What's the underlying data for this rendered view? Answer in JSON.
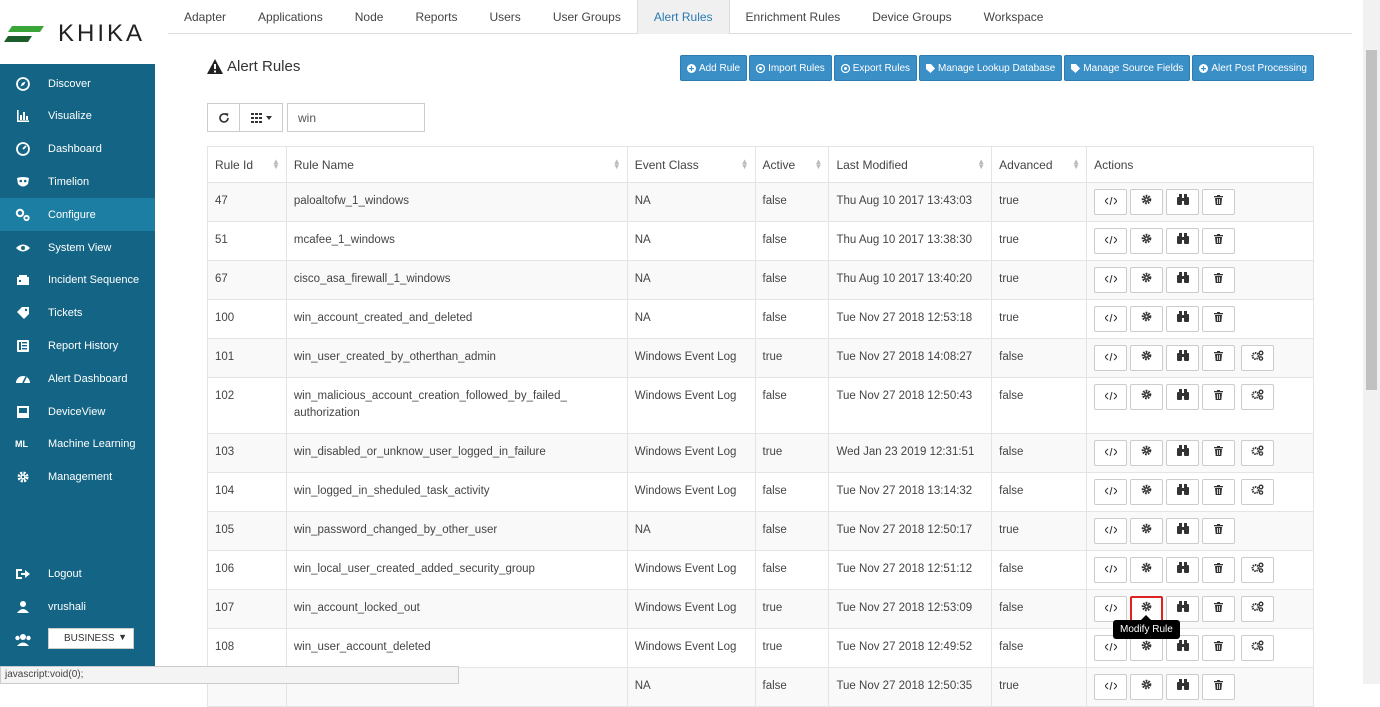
{
  "brand": {
    "name": "KHIKA"
  },
  "sidebar": {
    "items": [
      {
        "label": "Discover",
        "icon": "compass-icon"
      },
      {
        "label": "Visualize",
        "icon": "bar-chart-icon"
      },
      {
        "label": "Dashboard",
        "icon": "dashboard-icon"
      },
      {
        "label": "Timelion",
        "icon": "mask-icon"
      },
      {
        "label": "Configure",
        "icon": "cogs-icon",
        "active": true
      },
      {
        "label": "System View",
        "icon": "eye-icon"
      },
      {
        "label": "Incident Sequence",
        "icon": "incident-icon"
      },
      {
        "label": "Tickets",
        "icon": "tag-icon"
      },
      {
        "label": "Report History",
        "icon": "list-icon"
      },
      {
        "label": "Alert Dashboard",
        "icon": "gauge-icon"
      },
      {
        "label": "DeviceView",
        "icon": "device-icon"
      },
      {
        "label": "Machine Learning",
        "icon": "ml-icon"
      },
      {
        "label": "Management",
        "icon": "gear-icon"
      }
    ],
    "bottom": [
      {
        "label": "Logout",
        "icon": "logout-icon"
      },
      {
        "label": "vrushali",
        "icon": "user-icon"
      }
    ],
    "business_select": "BUSINESS"
  },
  "tabs": [
    "Adapter",
    "Applications",
    "Node",
    "Reports",
    "Users",
    "User Groups",
    "Alert Rules",
    "Enrichment Rules",
    "Device Groups",
    "Workspace"
  ],
  "active_tab": "Alert Rules",
  "page_title": "Alert Rules",
  "toolbar": {
    "add_rule": "Add Rule",
    "import_rules": "Import Rules",
    "export_rules": "Export Rules",
    "manage_lookup": "Manage Lookup Database",
    "manage_source": "Manage Source Fields",
    "alert_post": "Alert Post Processing"
  },
  "search": {
    "value": "win"
  },
  "table": {
    "columns": [
      "Rule Id",
      "Rule Name",
      "Event Class",
      "Active",
      "Last Modified",
      "Advanced",
      "Actions"
    ],
    "rows": [
      {
        "id": "47",
        "name": "paloaltofw_1_windows",
        "event_class": "NA",
        "active": "false",
        "modified": "Thu Aug 10 2017 13:43:03",
        "advanced": "true",
        "extra": false
      },
      {
        "id": "51",
        "name": "mcafee_1_windows",
        "event_class": "NA",
        "active": "false",
        "modified": "Thu Aug 10 2017 13:38:30",
        "advanced": "true",
        "extra": false
      },
      {
        "id": "67",
        "name": "cisco_asa_firewall_1_windows",
        "event_class": "NA",
        "active": "false",
        "modified": "Thu Aug 10 2017 13:40:20",
        "advanced": "true",
        "extra": false
      },
      {
        "id": "100",
        "name": "win_account_created_and_deleted",
        "event_class": "NA",
        "active": "false",
        "modified": "Tue Nov 27 2018 12:53:18",
        "advanced": "true",
        "extra": false
      },
      {
        "id": "101",
        "name": "win_user_created_by_otherthan_admin",
        "event_class": "Windows Event Log",
        "active": "true",
        "modified": "Tue Nov 27 2018 14:08:27",
        "advanced": "false",
        "extra": true
      },
      {
        "id": "102",
        "name": "win_malicious_account_creation_followed_by_failed_ authorization",
        "event_class": "Windows Event Log",
        "active": "false",
        "modified": "Tue Nov 27 2018 12:50:43",
        "advanced": "false",
        "extra": true
      },
      {
        "id": "103",
        "name": "win_disabled_or_unknow_user_logged_in_failure",
        "event_class": "Windows Event Log",
        "active": "true",
        "modified": "Wed Jan 23 2019 12:31:51",
        "advanced": "false",
        "extra": true
      },
      {
        "id": "104",
        "name": "win_logged_in_sheduled_task_activity",
        "event_class": "Windows Event Log",
        "active": "false",
        "modified": "Tue Nov 27 2018 13:14:32",
        "advanced": "false",
        "extra": true
      },
      {
        "id": "105",
        "name": "win_password_changed_by_other_user",
        "event_class": "NA",
        "active": "false",
        "modified": "Tue Nov 27 2018 12:50:17",
        "advanced": "true",
        "extra": false
      },
      {
        "id": "106",
        "name": "win_local_user_created_added_security_group",
        "event_class": "Windows Event Log",
        "active": "false",
        "modified": "Tue Nov 27 2018 12:51:12",
        "advanced": "false",
        "extra": true
      },
      {
        "id": "107",
        "name": "win_account_locked_out",
        "event_class": "Windows Event Log",
        "active": "true",
        "modified": "Tue Nov 27 2018 12:53:09",
        "advanced": "false",
        "extra": true,
        "hover": true
      },
      {
        "id": "108",
        "name": "win_user_account_deleted",
        "event_class": "Windows Event Log",
        "active": "true",
        "modified": "Tue Nov 27 2018 12:49:52",
        "advanced": "false",
        "extra": true
      },
      {
        "id": "",
        "name": "",
        "event_class": "NA",
        "active": "false",
        "modified": "Tue Nov 27 2018 12:50:35",
        "advanced": "true",
        "extra": false
      }
    ]
  },
  "tooltip": "Modify Rule",
  "statusbar": "javascript:void(0);",
  "colors": {
    "sidebar": "#146585",
    "sidebar_active": "#1d7ea3",
    "button": "#3a8fc7",
    "highlight": "#dd2222"
  }
}
